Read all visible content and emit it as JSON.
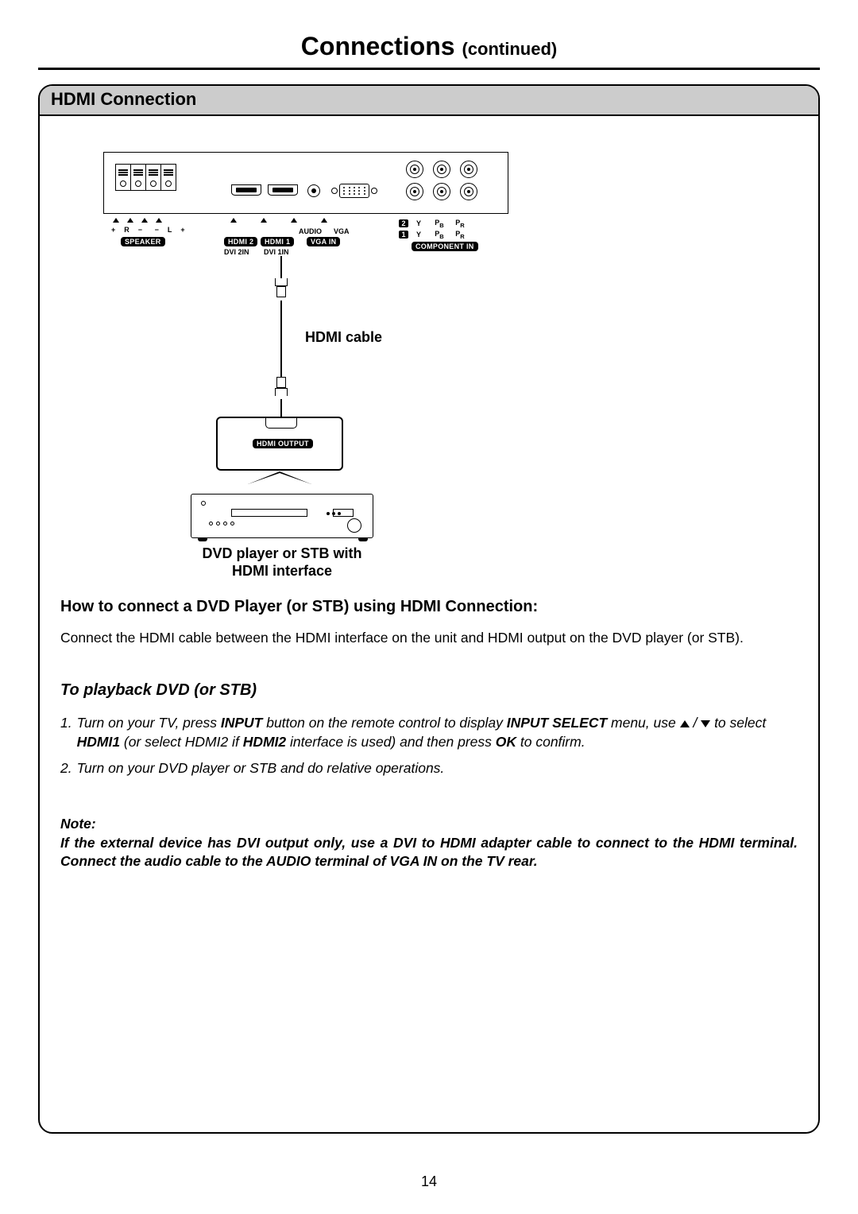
{
  "page": {
    "title_main": "Connections",
    "title_sub": "(continued)",
    "number": "14"
  },
  "section": {
    "header": "HDMI Connection"
  },
  "diagram": {
    "panel_labels": {
      "speaker": "SPEAKER",
      "r": "R",
      "l": "L",
      "plus": "+",
      "minus": "−",
      "hdmi2": "HDMI 2",
      "hdmi1": "HDMI 1",
      "dvi2": "DVI 2IN",
      "dvi1": "DVI 1IN",
      "audio": "AUDIO",
      "vga": "VGA",
      "vga_in": "VGA IN",
      "component_in": "COMPONENT IN",
      "y": "Y",
      "pb": "P",
      "pr": "P",
      "row1": "2",
      "row2": "1"
    },
    "hdmi_cable_label": "HDMI cable",
    "hdmi_output_badge": "HDMI OUTPUT",
    "device_caption_l1": "DVD player or STB with",
    "device_caption_l2": "HDMI interface"
  },
  "content": {
    "howto_heading": "How to connect a DVD Player (or STB) using HDMI Connection:",
    "howto_para": "Connect the HDMI cable between the HDMI interface on the unit and HDMI output on the DVD player (or STB).",
    "playback_heading": "To playback DVD (or STB)",
    "step1_a": "Turn on your TV, press ",
    "step1_b": "INPUT",
    "step1_c": " button on the remote control to display ",
    "step1_d": "INPUT SELECT",
    "step1_e": " menu, use ",
    "step1_f": " / ",
    "step1_g": " to select ",
    "step1_h": "HDMI1",
    "step1_i": " (or select HDMI2 if ",
    "step1_j": "HDMI2",
    "step1_k": " interface is used) and then press ",
    "step1_l": "OK",
    "step1_m": " to confirm.",
    "step2": "Turn on your DVD player or STB and do relative operations.",
    "note_label": "Note:",
    "note_body_a": "If the external device has DVI output only, use a DVI to HDMI adapter cable to connect to the HDMI terminal. Connect the audio cable to the AUDIO terminal of ",
    "note_body_b": "VGA IN",
    "note_body_c": " on the TV rear."
  }
}
